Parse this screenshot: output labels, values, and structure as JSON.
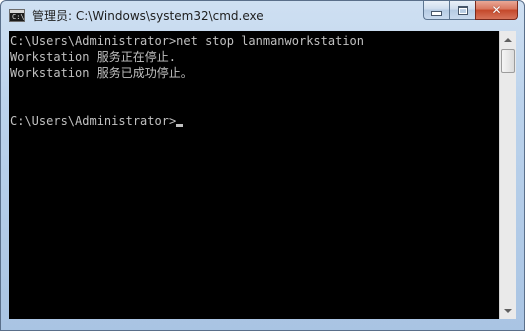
{
  "window": {
    "title": "管理员: C:\\Windows\\system32\\cmd.exe",
    "icon": "cmd-console-icon",
    "icon_text": "C:\\"
  },
  "caption_buttons": {
    "minimize_icon": "minimize-icon",
    "maximize_icon": "maximize-icon",
    "close_icon": "close-icon",
    "close_glyph": "✕"
  },
  "console": {
    "lines": [
      "C:\\Users\\Administrator>net stop lanmanworkstation",
      "Workstation 服务正在停止.",
      "Workstation 服务已成功停止。",
      "",
      "C:\\Users\\Administrator>"
    ],
    "text_color": "#c0c0c0",
    "background_color": "#000000"
  },
  "scrollbar": {
    "up_icon": "scroll-up-arrow-icon",
    "down_icon": "scroll-down-arrow-icon"
  }
}
